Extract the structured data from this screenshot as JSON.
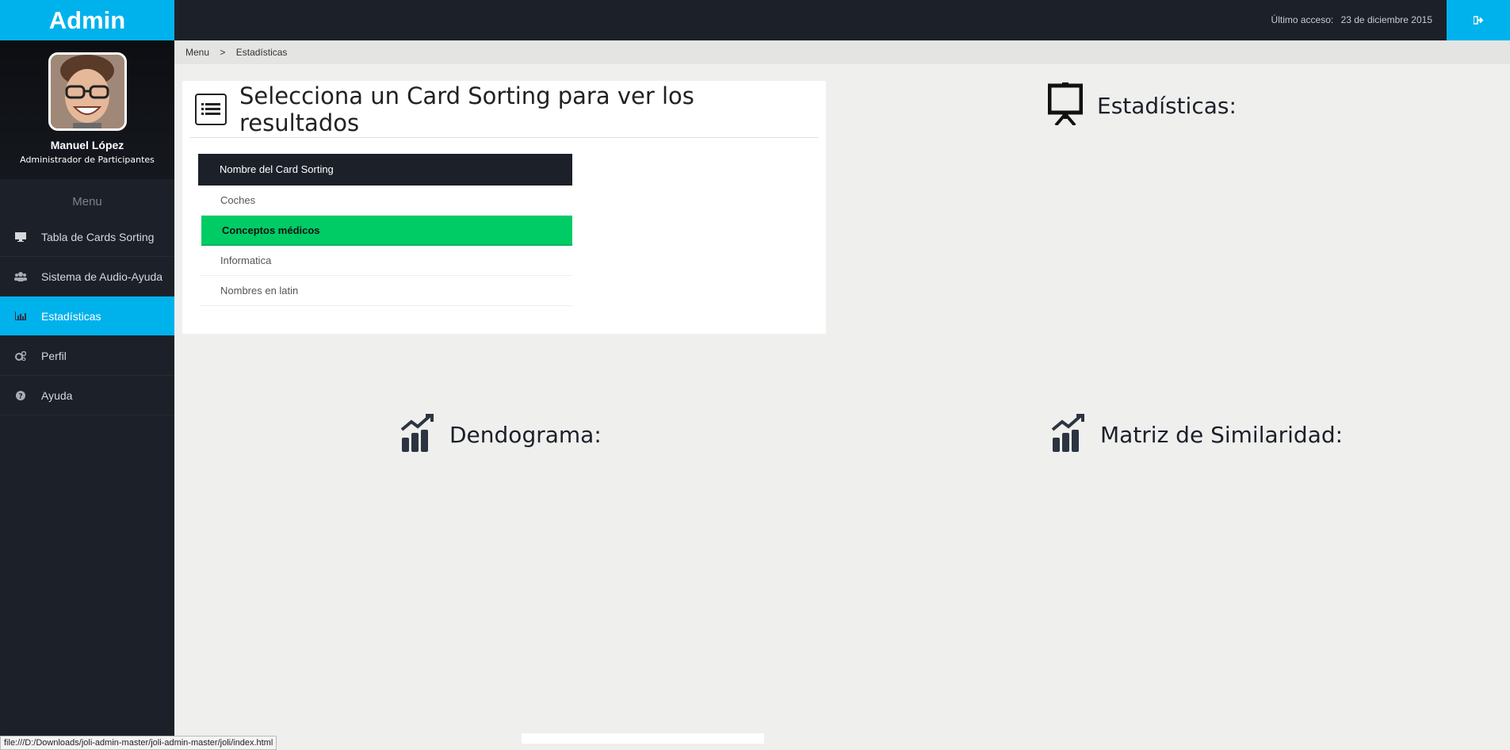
{
  "brand": "Admin",
  "profile": {
    "name": "Manuel López",
    "role": "Administrador de Participantes"
  },
  "menu_title": "Menu",
  "nav": [
    {
      "label": "Tabla de Cards Sorting",
      "icon": "monitor-icon"
    },
    {
      "label": "Sistema de Audio-Ayuda",
      "icon": "users-icon"
    },
    {
      "label": "Estadísticas",
      "icon": "bar-chart-icon"
    },
    {
      "label": "Perfil",
      "icon": "cogs-icon"
    },
    {
      "label": "Ayuda",
      "icon": "question-icon"
    }
  ],
  "topbar": {
    "last_access_label": "Último acceso:",
    "last_access_date": "23 de diciembre 2015",
    "logout_icon": "sign-out-icon"
  },
  "breadcrumb": {
    "root": "Menu",
    "separator": ">",
    "current": "Estadísticas"
  },
  "panel": {
    "title": "Selecciona un Card Sorting para ver los resultados",
    "column_header": "Nombre del Card Sorting",
    "rows": [
      "Coches",
      "Conceptos médicos",
      "Informatica",
      "Nombres en latin"
    ]
  },
  "sections": {
    "stats": "Estadísticas:",
    "dendogram": "Dendograma:",
    "matrix": "Matriz de Similaridad:"
  },
  "status_bar": "file:///D:/Downloads/joli-admin-master/joli-admin-master/joli/index.html",
  "colors": {
    "accent": "#00b2ec",
    "dark": "#1c2029",
    "selected": "#00cc66"
  }
}
